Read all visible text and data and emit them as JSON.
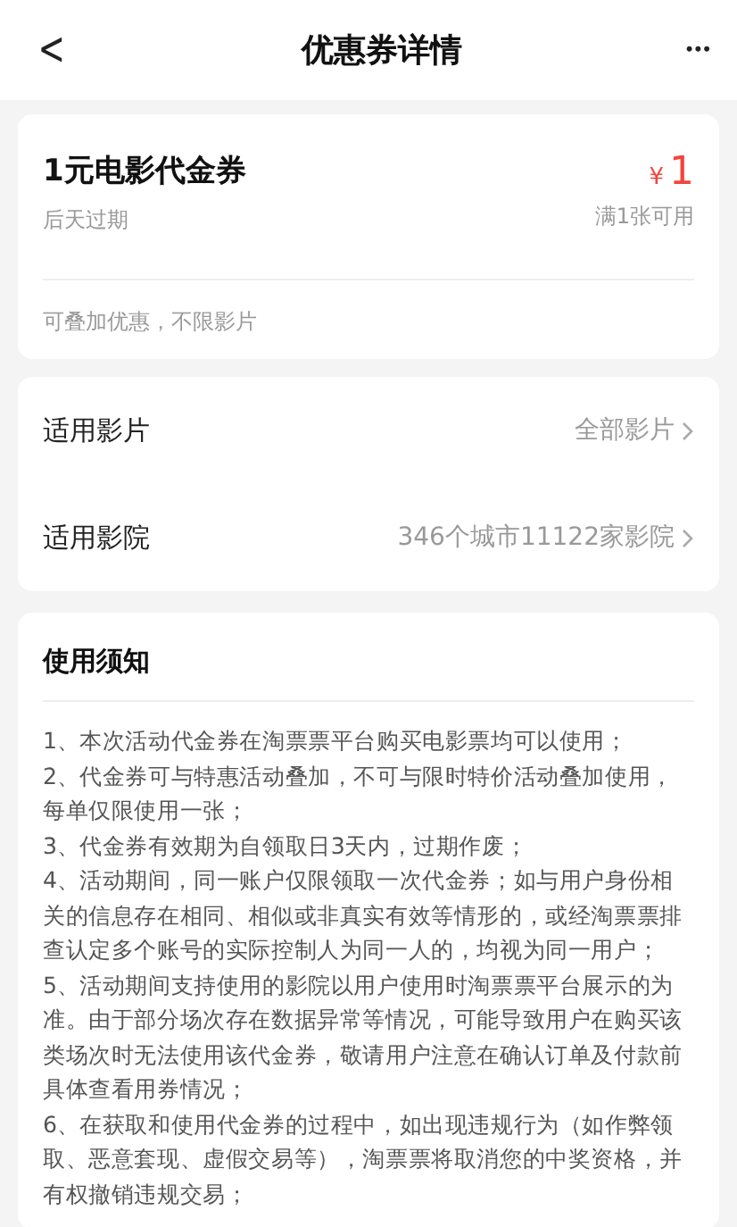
{
  "header": {
    "title": "优惠券详情",
    "back": "<",
    "more": "•••"
  },
  "coupon": {
    "name": "1元电影代金券",
    "expiry": "后天过期",
    "currency": "¥",
    "amount": "1",
    "condition": "满1张可用",
    "note": "可叠加优惠，不限影片"
  },
  "scope": [
    {
      "label": "适用影片",
      "value": "全部影片"
    },
    {
      "label": "适用影院",
      "value": "346个城市11122家影院"
    }
  ],
  "rules": {
    "title": "使用须知",
    "items": [
      "1、本次活动代金券在淘票票平台购买电影票均可以使用；",
      "2、代金券可与特惠活动叠加，不可与限时特价活动叠加使用，每单仅限使用一张；",
      "3、代金券有效期为自领取日3天内，过期作废；",
      "4、活动期间，同一账户仅限领取一次代金券；如与用户身份相关的信息存在相同、相似或非真实有效等情形的，或经淘票票排查认定多个账号的实际控制人为同一人的，均视为同一用户；",
      "5、活动期间支持使用的影院以用户使用时淘票票平台展示的为准。由于部分场次存在数据异常等情况，可能导致用户在购买该类场次时无法使用该代金券，敬请用户注意在确认订单及付款前具体查看用券情况；",
      "6、在获取和使用代金券的过程中，如出现违规行为（如作弊领取、恶意套现、虚假交易等），淘票票将取消您的中奖资格，并有权撤销违规交易；"
    ]
  }
}
